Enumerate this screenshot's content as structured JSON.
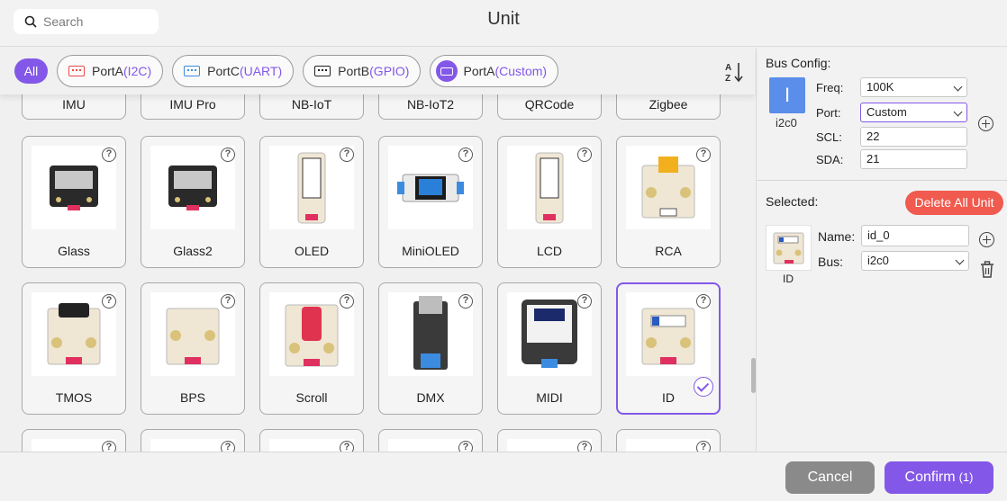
{
  "header": {
    "search_placeholder": "Search",
    "title": "Unit",
    "search_icon": "search-icon"
  },
  "filters": {
    "all_label": "All",
    "chips": [
      {
        "label": "PortA",
        "sub": "(I2C)",
        "icon_color": "#e94b4b"
      },
      {
        "label": "PortC",
        "sub": "(UART)",
        "icon_color": "#3b8ce0"
      },
      {
        "label": "PortB",
        "sub": "(GPIO)",
        "icon_color": "#222222"
      },
      {
        "label": "PortA",
        "sub": "(Custom)",
        "icon_color": "#8358e8"
      }
    ],
    "sort_icon": "sort-az-icon"
  },
  "grid": {
    "row0": [
      "IMU",
      "IMU Pro",
      "NB-IoT",
      "NB-IoT2",
      "QRCode",
      "Zigbee"
    ],
    "row1": [
      "Glass",
      "Glass2",
      "OLED",
      "MiniOLED",
      "LCD",
      "RCA"
    ],
    "row2": [
      "TMOS",
      "BPS",
      "Scroll",
      "DMX",
      "MIDI",
      "ID"
    ],
    "help_glyph": "?",
    "selected": "ID"
  },
  "panel": {
    "bus_config_label": "Bus Config:",
    "bus_glyph": "I",
    "bus_name": "i2c0",
    "freq_label": "Freq:",
    "freq_value": "100K",
    "port_label": "Port:",
    "port_value": "Custom",
    "scl_label": "SCL:",
    "scl_value": "22",
    "sda_label": "SDA:",
    "sda_value": "21",
    "selected_label": "Selected:",
    "delete_all": "Delete All Unit",
    "selected_unit": {
      "caption": "ID",
      "name_label": "Name:",
      "name_value": "id_0",
      "bus_label": "Bus:",
      "bus_value": "i2c0"
    }
  },
  "footer": {
    "cancel": "Cancel",
    "confirm": "Confirm",
    "confirm_count": "(1)"
  },
  "colors": {
    "accent": "#8358e8",
    "danger": "#f05a4f",
    "bus_blue": "#5b8dea"
  }
}
